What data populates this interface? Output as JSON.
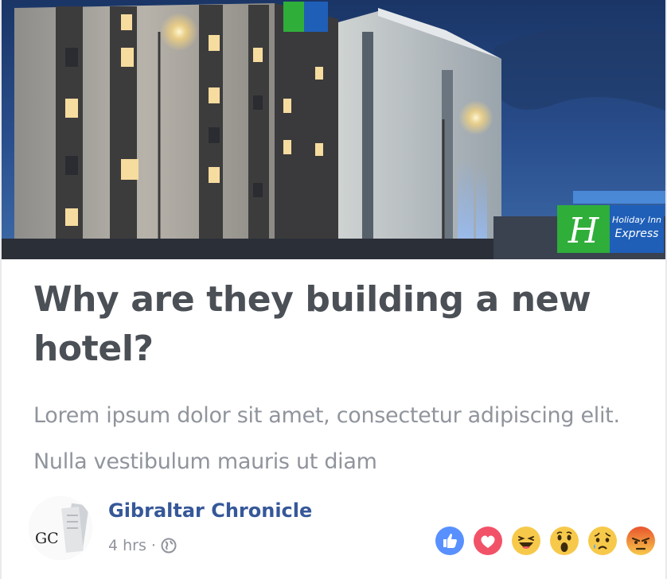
{
  "hero": {
    "alt": "Holiday Inn Express hotel at dusk",
    "sign_brand_line1": "Holiday Inn",
    "sign_brand_line2": "Express",
    "sign_logo_letter": "H"
  },
  "headline": "Why are they building a new hotel?",
  "summary": "Lorem ipsum dolor sit amet, consectetur adipiscing elit. Nulla vestibulum mauris ut diam",
  "publisher": {
    "avatar_text": "GC",
    "name": "Gibraltar Chronicle",
    "time": "4 hrs",
    "separator": "·",
    "audience_icon": "globe-icon"
  },
  "reactions": [
    {
      "name": "like",
      "icon": "like-icon",
      "color": "#5890ff"
    },
    {
      "name": "love",
      "icon": "love-icon",
      "color": "#f25268"
    },
    {
      "name": "haha",
      "icon": "haha-icon",
      "color": "#f7c94b"
    },
    {
      "name": "wow",
      "icon": "wow-icon",
      "color": "#f7c94b"
    },
    {
      "name": "sad",
      "icon": "sad-icon",
      "color": "#f7c94b"
    },
    {
      "name": "angry",
      "icon": "angry-icon",
      "color": "#f06b3a"
    }
  ],
  "colors": {
    "headline": "#4b4f56",
    "summary": "#90949c",
    "link": "#365899",
    "sign_green": "#2fae3a",
    "sign_blue": "#1f5fb8"
  }
}
